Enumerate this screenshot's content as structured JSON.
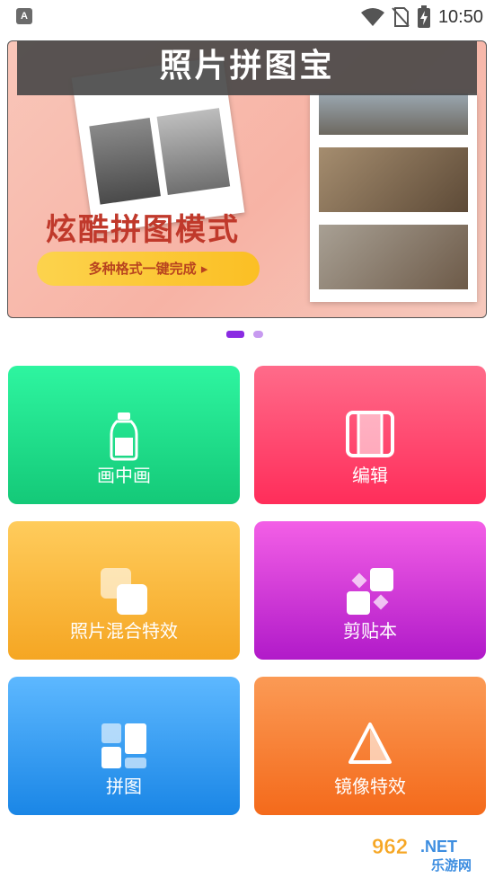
{
  "status_bar": {
    "left_icon_letter": "A",
    "time": "10:50"
  },
  "banner": {
    "app_title": "照片拼图宝",
    "headline": "炫酷拼图模式",
    "cta_label": "多种格式一键完成 ▸"
  },
  "carousel": {
    "active_index": 0,
    "count": 2
  },
  "tiles": [
    {
      "label": "画中画",
      "icon": "bottle-icon"
    },
    {
      "label": "编辑",
      "icon": "edit-frame-icon"
    },
    {
      "label": "照片混合特效",
      "icon": "overlap-squares-icon"
    },
    {
      "label": "剪贴本",
      "icon": "scrapbook-icon"
    },
    {
      "label": "拼图",
      "icon": "collage-grid-icon"
    },
    {
      "label": "镜像特效",
      "icon": "mirror-triangle-icon"
    }
  ],
  "watermark": {
    "text_top": "962.NET",
    "text_bottom": "乐游网"
  },
  "colors": {
    "pip": [
      "#2ef5a0",
      "#14c978"
    ],
    "edit": [
      "#ff6b8a",
      "#ff2d5a"
    ],
    "blend": [
      "#ffcc5c",
      "#f5a623"
    ],
    "scrapbook": [
      "#f35fe6",
      "#b11ac9"
    ],
    "collage": [
      "#5db8ff",
      "#1a86e6"
    ],
    "mirror": [
      "#fb9a55",
      "#f46a1b"
    ]
  }
}
